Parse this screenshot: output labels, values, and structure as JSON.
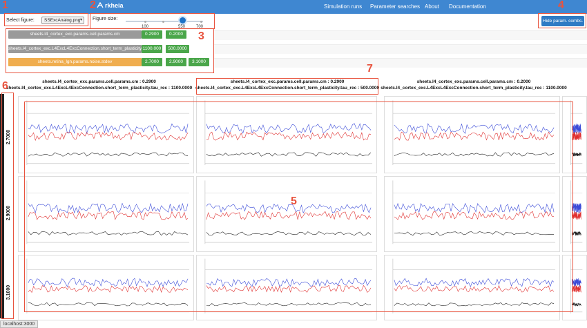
{
  "navbar": {
    "brand": "rkheia",
    "links": [
      "Simulation runs",
      "Parameter searches",
      "About",
      "Documentation"
    ]
  },
  "controls": {
    "select_figure_label": "Select figure:",
    "select_figure_value": "SSExcAnalog.png",
    "figure_size_label": "Figure size:",
    "figure_size_ticks": [
      "100",
      "550",
      "700"
    ],
    "hide_button": "Hide param. combs."
  },
  "params": [
    {
      "name": "sheets.l4_cortex_exc.params.cell.params.cm",
      "color": "#9a9a9a",
      "values": [
        "0.2900",
        "0.2000"
      ]
    },
    {
      "name": "sheets.l4_cortex_exc.L4ExcL4ExcConnection.short_term_plasticity.tau_rec",
      "color": "#9a9a9a",
      "values": [
        "1100.000",
        "500.0000"
      ]
    },
    {
      "name": "sheets.retina_lgn.params.noise.stdev",
      "color": "#f0ad4e",
      "values": [
        "2.7000",
        "2.9000",
        "3.1000"
      ]
    }
  ],
  "columns": [
    {
      "line1": "sheets.l4_cortex_exc.params.cell.params.cm : 0.2900",
      "line2": "sheets.l4_cortex_exc.L4ExcL4ExcConnection.short_term_plasticity.tau_rec : 1100.0000"
    },
    {
      "line1": "sheets.l4_cortex_exc.params.cell.params.cm : 0.2900",
      "line2": "sheets.l4_cortex_exc.L4ExcL4ExcConnection.short_term_plasticity.tau_rec : 500.0000"
    },
    {
      "line1": "sheets.l4_cortex_exc.params.cell.params.cm : 0.2000",
      "line2": "sheets.l4_cortex_exc.L4ExcL4ExcConnection.short_term_plasticity.tau_rec : 1100.0000"
    }
  ],
  "rows": [
    "2.7000",
    "2.9000",
    "3.1000"
  ],
  "status_bar": "localhost:3000",
  "annotations": [
    "1",
    "2",
    "3",
    "4",
    "5",
    "6",
    "7"
  ],
  "colors": {
    "navbar": "#3f87d1",
    "accent": "#e8533e",
    "value_button": "#4aa64a"
  }
}
